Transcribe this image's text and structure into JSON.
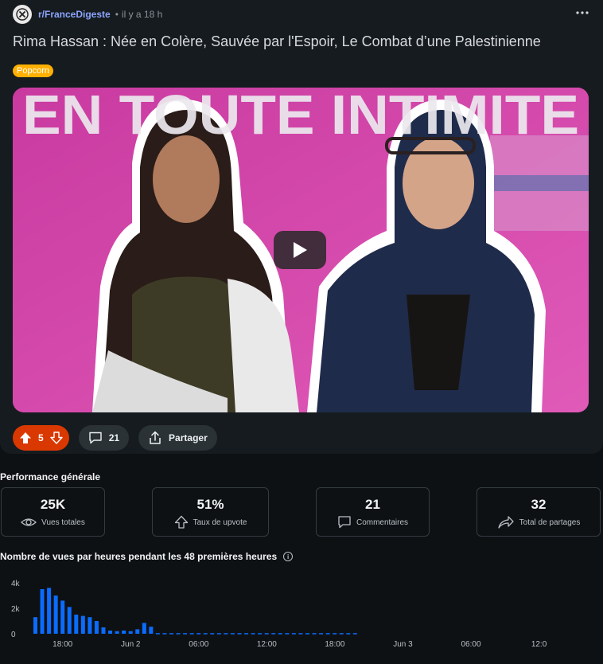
{
  "post": {
    "subreddit": "r/FranceDigeste",
    "separator": "•",
    "time": "il y a 18 h",
    "title": "Rima Hassan : Née en Colère, Sauvée par l'Espoir, Le Combat d’une Palestinienne",
    "flair": "Popcorn",
    "thumbnail_text": "EN TOUTE INTIMITE",
    "upvotes": "5",
    "comments": "21",
    "share_label": "Partager"
  },
  "performance": {
    "title": "Performance générale",
    "stats": [
      {
        "value": "25K",
        "label": "Vues totales",
        "icon": "eye-icon"
      },
      {
        "value": "51%",
        "label": "Taux de upvote",
        "icon": "upvote-icon"
      },
      {
        "value": "21",
        "label": "Commentaires",
        "icon": "comments-icon"
      },
      {
        "value": "32",
        "label": "Total de partages",
        "icon": "share-arrow-icon"
      }
    ]
  },
  "chart_data": {
    "type": "bar",
    "title": "Nombre de vues par heures pendant les 48 premières heures",
    "y_tick_labels": [
      "0",
      "2k",
      "4k"
    ],
    "x_tick_labels": [
      "18:00",
      "Jun 2",
      "06:00",
      "12:00",
      "18:00",
      "Jun 3",
      "06:00",
      "12:0"
    ],
    "ylim": [
      0,
      4000
    ],
    "bar_color": "#0a6cff",
    "values": [
      1300,
      3500,
      3600,
      3000,
      2600,
      2100,
      1500,
      1400,
      1300,
      1000,
      500,
      250,
      200,
      250,
      200,
      350,
      850,
      550,
      50,
      50,
      50,
      50,
      50,
      50,
      50,
      50,
      50,
      50,
      50,
      50,
      50,
      50,
      50,
      50,
      50,
      50,
      50,
      50,
      50,
      50,
      50,
      50,
      50,
      50,
      50,
      50,
      50,
      50
    ]
  },
  "colors": {
    "accent": "#d93900",
    "link": "#8ba5ff",
    "flair": "#ffb000",
    "bar": "#0a6cff"
  }
}
